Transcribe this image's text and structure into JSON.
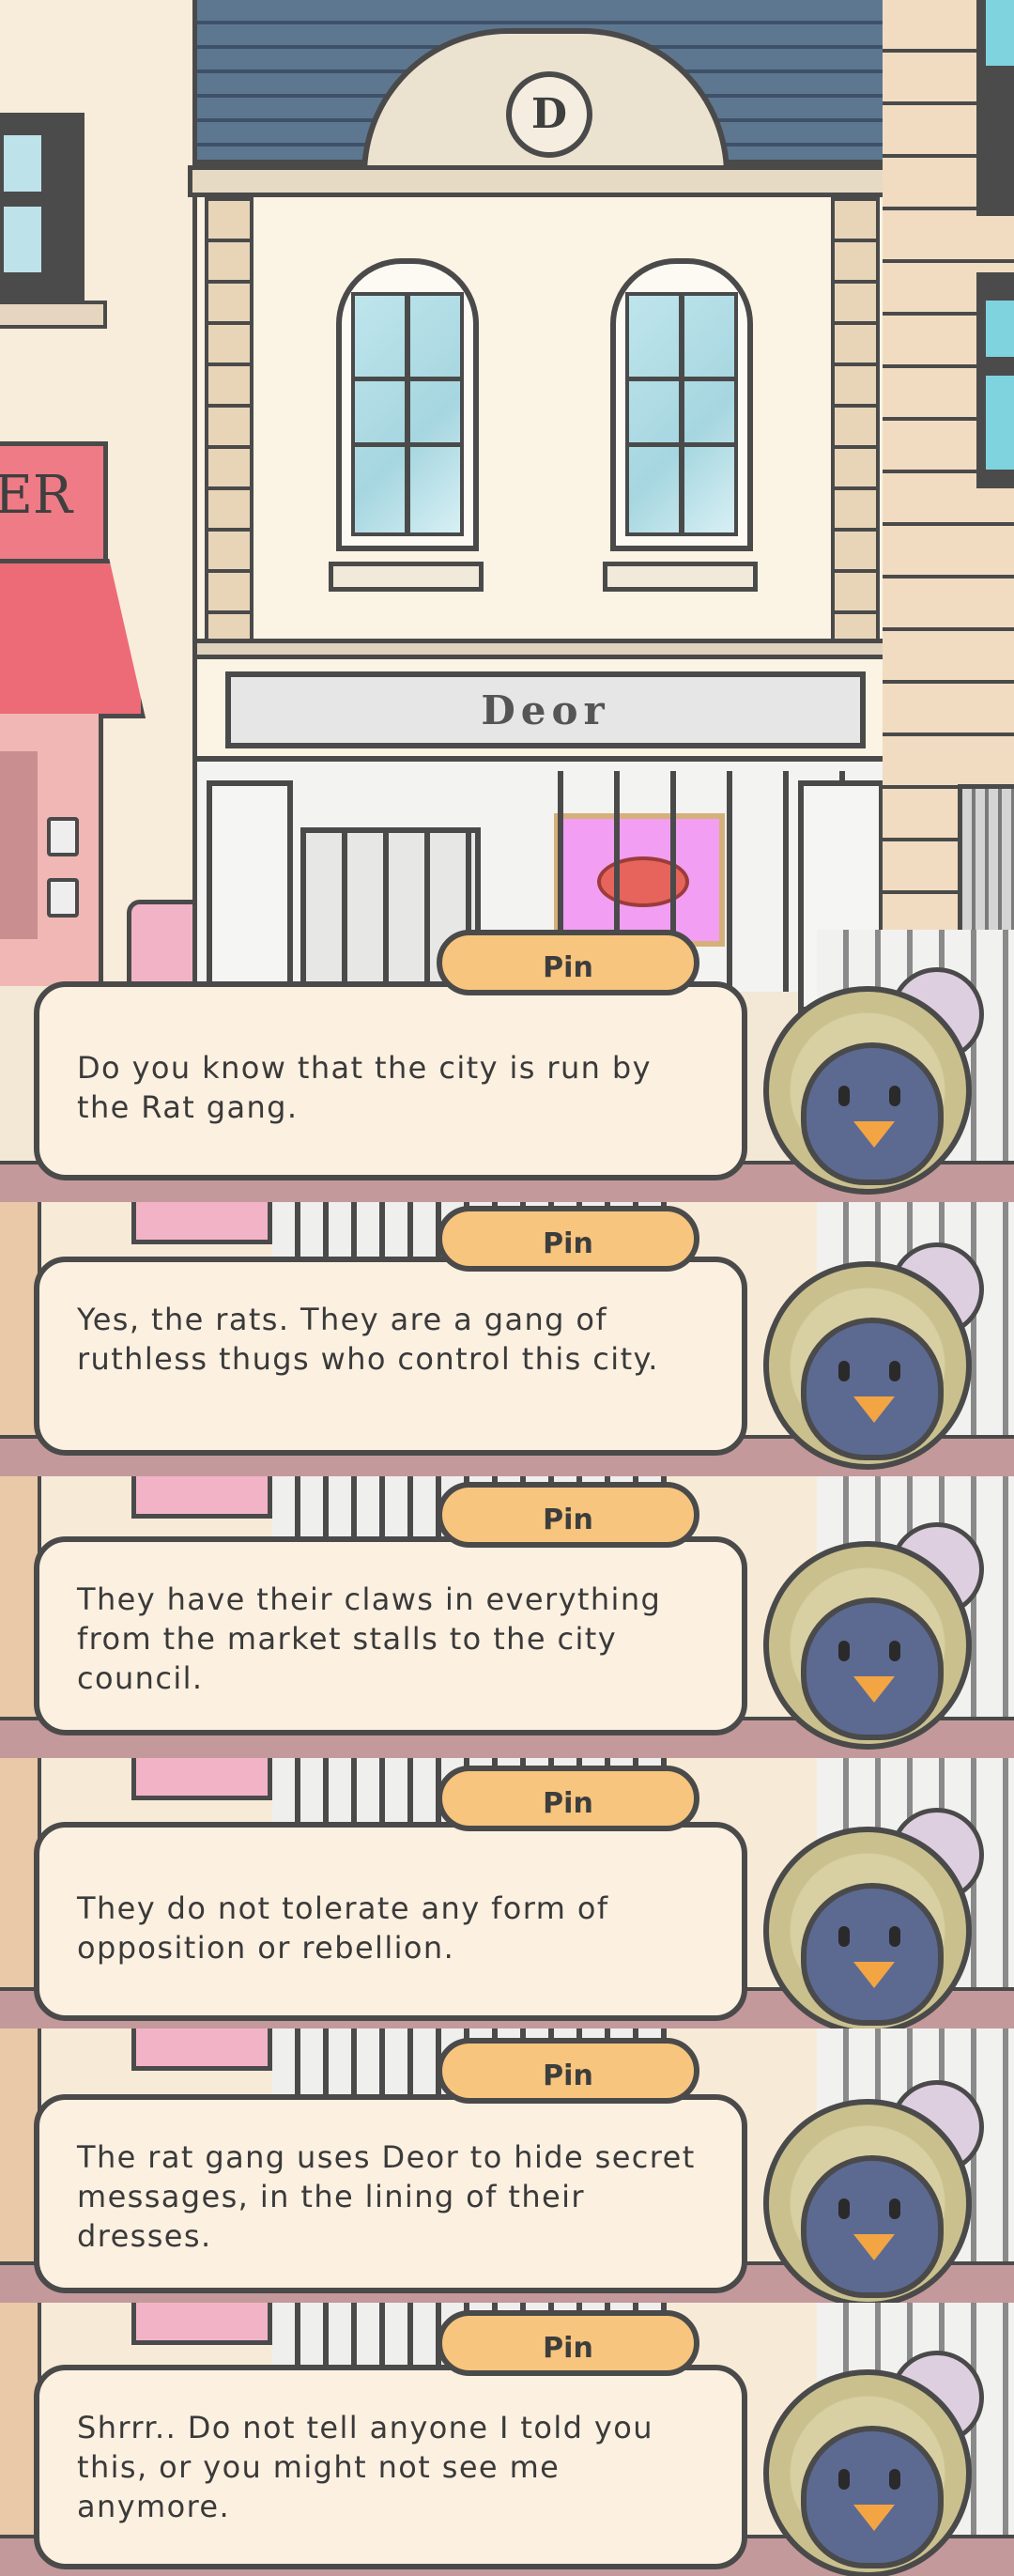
{
  "scene": {
    "shop_name": "Deor",
    "crest_letter": "D",
    "left_sign_text": "ER"
  },
  "dialogues": [
    {
      "speaker": "Pin",
      "text": "Do you know that the city is run by the Rat gang."
    },
    {
      "speaker": "Pin",
      "text": "Yes, the rats. They are a gang of ruthless thugs who control this city."
    },
    {
      "speaker": "Pin",
      "text": "They have their claws in everything from the market stalls to the city council."
    },
    {
      "speaker": "Pin",
      "text": "They do not tolerate any form of opposition or rebellion."
    },
    {
      "speaker": "Pin",
      "text": "The rat gang uses Deor to hide secret messages, in the lining of their dresses."
    },
    {
      "speaker": "Pin",
      "text": "Shrrr.. Do not tell anyone I told you this, or you might not see me anymore."
    }
  ],
  "colors": {
    "name_tab": "#f7c57d",
    "bubble": "#fcf0e1",
    "outline": "#4a4a4a"
  },
  "icons": [
    "character-avatar-icon"
  ]
}
